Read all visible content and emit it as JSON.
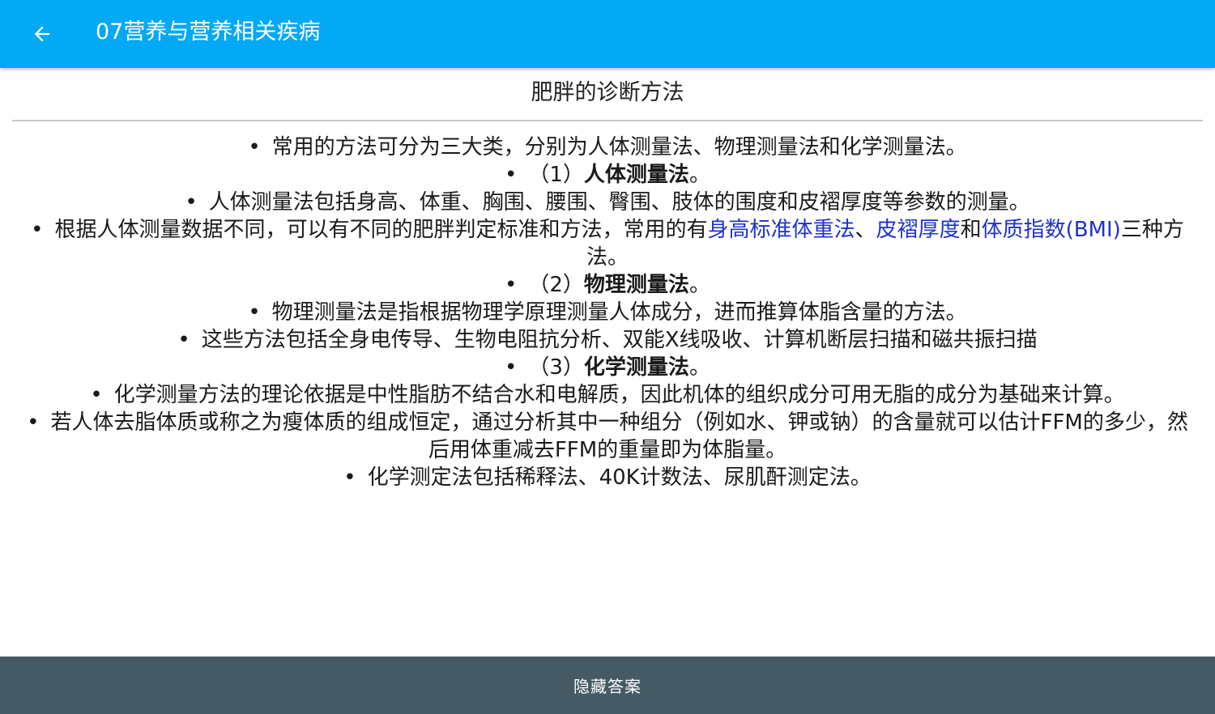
{
  "appbar": {
    "title": "07营养与营养相关疾病",
    "back_icon": "arrow-left-icon",
    "background": "#03a9f4"
  },
  "card": {
    "title": "肥胖的诊断方法"
  },
  "bullet_char": "•",
  "content": {
    "p1": "常用的方法可分为三大类，分别为人体测量法、物理测量法和化学测量法。",
    "p2_prefix": "（1）",
    "p2_bold": "人体测量法",
    "p2_suffix": "。",
    "p3": "人体测量法包括身高、体重、胸围、腰围、臀围、肢体的围度和皮褶厚度等参数的测量。",
    "p4_a": "根据人体测量数据不同，可以有不同的肥胖判定标准和方法，常用的有",
    "p4_link1": "身高标准体重法",
    "p4_b": "、",
    "p4_link2": "皮褶厚度",
    "p4_c": "和",
    "p4_link3": "体质指数(BMI)",
    "p4_d": "三种方法。",
    "p5_prefix": "（2）",
    "p5_bold": "物理测量法",
    "p5_suffix": "。",
    "p6": "物理测量法是指根据物理学原理测量人体成分，进而推算体脂含量的方法。",
    "p7": "这些方法包括全身电传导、生物电阻抗分析、双能X线吸收、计算机断层扫描和磁共振扫描",
    "p8_prefix": "（3）",
    "p8_bold": "化学测量法",
    "p8_suffix": "。",
    "p9": "化学测量方法的理论依据是中性脂肪不结合水和电解质，因此机体的组织成分可用无脂的成分为基础来计算。",
    "p10": "若人体去脂体质或称之为瘦体质的组成恒定，通过分析其中一种组分（例如水、钾或钠）的含量就可以估计FFM的多少，然后用体重减去FFM的重量即为体脂量。",
    "p11": "化学测定法包括稀释法、40K计数法、尿肌酐测定法。"
  },
  "colors": {
    "highlight": "#1e32c8",
    "bottombar": "#455a64"
  },
  "bottombar": {
    "label": "隐藏答案"
  }
}
